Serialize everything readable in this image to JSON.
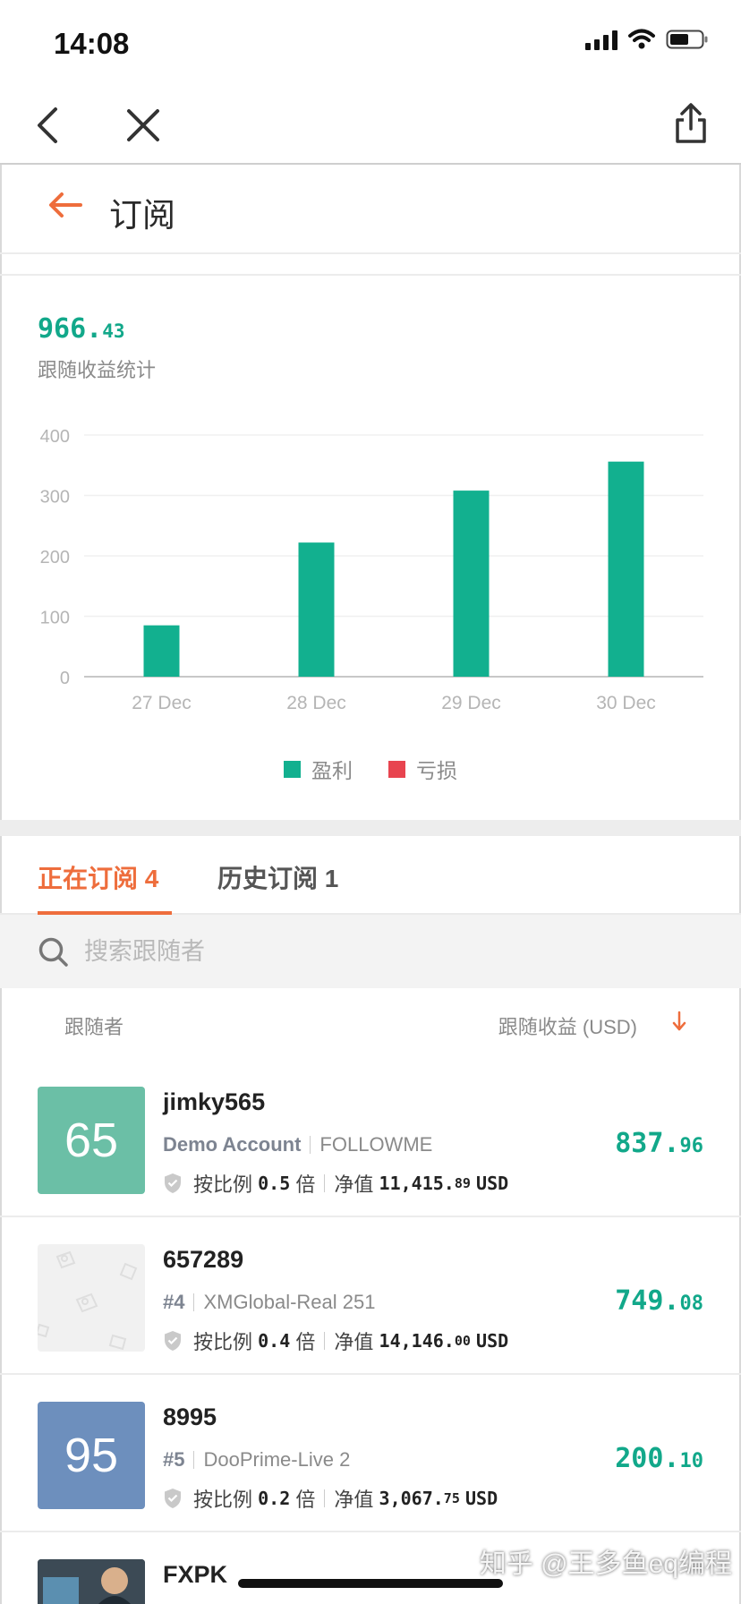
{
  "status_bar": {
    "time": "14:08"
  },
  "page": {
    "title": "订阅"
  },
  "summary": {
    "total_int": "966.",
    "total_dec": "43",
    "label": "跟随收益统计"
  },
  "chart_data": {
    "type": "bar",
    "categories": [
      "27 Dec",
      "28 Dec",
      "29 Dec",
      "30 Dec"
    ],
    "series": [
      {
        "name": "盈利",
        "color": "#12b08f",
        "values": [
          85,
          222,
          308,
          356
        ]
      },
      {
        "name": "亏损",
        "color": "#e8444f",
        "values": [
          0,
          0,
          0,
          0
        ]
      }
    ],
    "yticks": [
      0,
      100,
      200,
      300,
      400
    ],
    "ylim": [
      0,
      400
    ],
    "grid": true,
    "legend_position": "bottom"
  },
  "tabs": [
    {
      "label": "正在订阅",
      "count": "4",
      "active": true
    },
    {
      "label": "历史订阅",
      "count": "1",
      "active": false
    }
  ],
  "search": {
    "placeholder": "搜索跟随者"
  },
  "list_header": {
    "left": "跟随者",
    "right": "跟随收益 (USD)"
  },
  "followers": [
    {
      "avatar_text": "65",
      "avatar_color": "#6bbfa6",
      "name": "jimky565",
      "tag": "Demo Account",
      "broker": "FOLLOWME",
      "ratio_label": "按比例",
      "ratio": "0.5",
      "ratio_unit": "倍",
      "equity_label": "净值",
      "equity_int": "11,415.",
      "equity_dec": "89",
      "currency": "USD",
      "profit_int": "837.",
      "profit_dec": "96"
    },
    {
      "avatar_text": "",
      "avatar_color": "#f1f1f1",
      "name": "657289",
      "tag": "#4",
      "broker": "XMGlobal-Real 251",
      "ratio_label": "按比例",
      "ratio": "0.4",
      "ratio_unit": "倍",
      "equity_label": "净值",
      "equity_int": "14,146.",
      "equity_dec": "00",
      "currency": "USD",
      "profit_int": "749.",
      "profit_dec": "08"
    },
    {
      "avatar_text": "95",
      "avatar_color": "#6d8fbd",
      "name": "8995",
      "tag": "#5",
      "broker": "DooPrime-Live 2",
      "ratio_label": "按比例",
      "ratio": "0.2",
      "ratio_unit": "倍",
      "equity_label": "净值",
      "equity_int": "3,067.",
      "equity_dec": "75",
      "currency": "USD",
      "profit_int": "200.",
      "profit_dec": "10"
    },
    {
      "name": "FXPK"
    }
  ],
  "watermark": "知乎 @王多鱼eq编程"
}
